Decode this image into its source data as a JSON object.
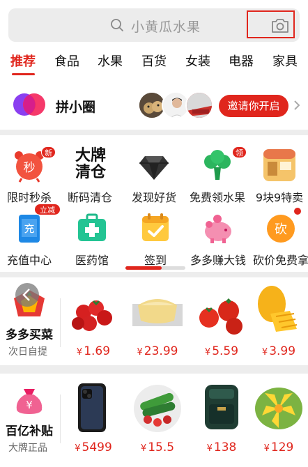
{
  "search": {
    "placeholder": "小黄瓜水果"
  },
  "tabs": [
    "推荐",
    "食品",
    "水果",
    "百货",
    "女装",
    "电器",
    "家具"
  ],
  "circle": {
    "title": "拼小圈",
    "invite_label": "邀请你开启"
  },
  "grid": [
    {
      "label": "限时秒杀",
      "icon": "alarm-clock-icon",
      "badge": "新",
      "glyph": "秒"
    },
    {
      "label": "断码清仓",
      "icon": "clearance-icon",
      "glyph_top": "大牌",
      "glyph_bottom": "清仓"
    },
    {
      "label": "发现好货",
      "icon": "diamond-icon"
    },
    {
      "label": "免费领水果",
      "icon": "broccoli-icon",
      "badge": "领"
    },
    {
      "label": "9块9特卖",
      "icon": "shop-icon"
    },
    {
      "label": "充值中心",
      "icon": "phone-recharge-icon",
      "badge": "立减2元",
      "glyph": "充"
    },
    {
      "label": "医药馆",
      "icon": "medical-kit-icon"
    },
    {
      "label": "签到",
      "icon": "calendar-check-icon"
    },
    {
      "label": "多多赚大钱",
      "icon": "piggy-bank-icon"
    },
    {
      "label": "砍价免费拿",
      "icon": "bargain-icon",
      "glyph": "砍"
    }
  ],
  "grid_progress": 0.6,
  "sections": [
    {
      "title": "多多买菜",
      "subtitle": "次日自提",
      "products": [
        {
          "icon": "cherry-tomatoes-image",
          "price": "1.69"
        },
        {
          "icon": "cake-image",
          "price": "23.99"
        },
        {
          "icon": "tomatoes-image",
          "price": "5.59"
        },
        {
          "icon": "mango-image",
          "price": "3.99"
        }
      ]
    },
    {
      "title": "百亿补贴",
      "subtitle": "大牌正品",
      "products": [
        {
          "icon": "smartphone-image",
          "price": "5499"
        },
        {
          "icon": "vegetables-bowl-image",
          "price": "15.5"
        },
        {
          "icon": "air-fryer-image",
          "price": "138"
        },
        {
          "icon": "durian-image",
          "price": "129"
        }
      ]
    }
  ],
  "currency": "¥",
  "colors": {
    "accent": "#e0261d"
  }
}
